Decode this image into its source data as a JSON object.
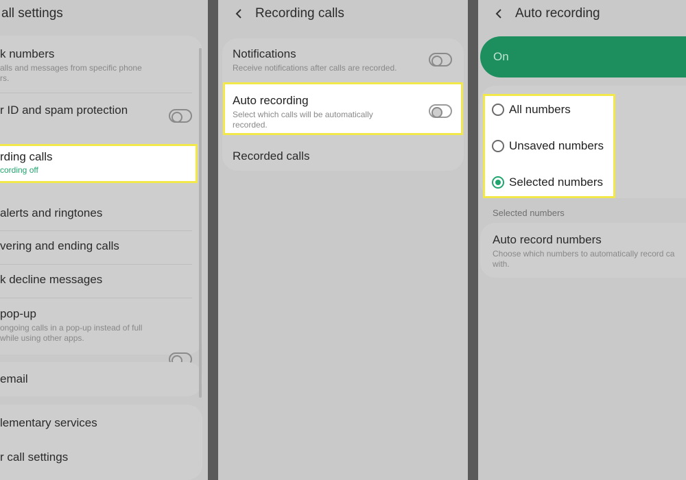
{
  "panel1": {
    "header": "all settings",
    "items": [
      {
        "title": "k numbers",
        "sub1": "alls and messages from specific phone",
        "sub2": "rs."
      },
      {
        "title": "r ID and spam protection"
      },
      {
        "title": "rding calls",
        "sub1": "cording off"
      },
      {
        "title": "alerts and ringtones"
      },
      {
        "title": "vering and ending calls"
      },
      {
        "title": "k decline messages"
      },
      {
        "title": "pop-up",
        "sub1": "ongoing calls in a pop-up instead of full",
        "sub2": "while using other apps."
      },
      {
        "title": "email"
      },
      {
        "title": "lementary services"
      },
      {
        "title": "r call settings"
      }
    ]
  },
  "panel2": {
    "header": "Recording calls",
    "items": [
      {
        "title": "Notifications",
        "sub1": "Receive notifications after calls are recorded."
      },
      {
        "title": "Auto recording",
        "sub1": "Select which calls will be automatically",
        "sub2": "recorded."
      },
      {
        "title": "Recorded calls"
      }
    ]
  },
  "panel3": {
    "header": "Auto recording",
    "master_label": "On",
    "options": [
      "All numbers",
      "Unsaved numbers",
      "Selected numbers"
    ],
    "selected_index": 2,
    "section_header": "Selected numbers",
    "auto_record": {
      "title": "Auto record numbers",
      "sub1": "Choose which numbers to automatically record ca",
      "sub2": "with."
    }
  },
  "colors": {
    "accent_green": "#1fa56d",
    "highlight_yellow": "#f3e84a",
    "status_green": "#1fa56d"
  }
}
